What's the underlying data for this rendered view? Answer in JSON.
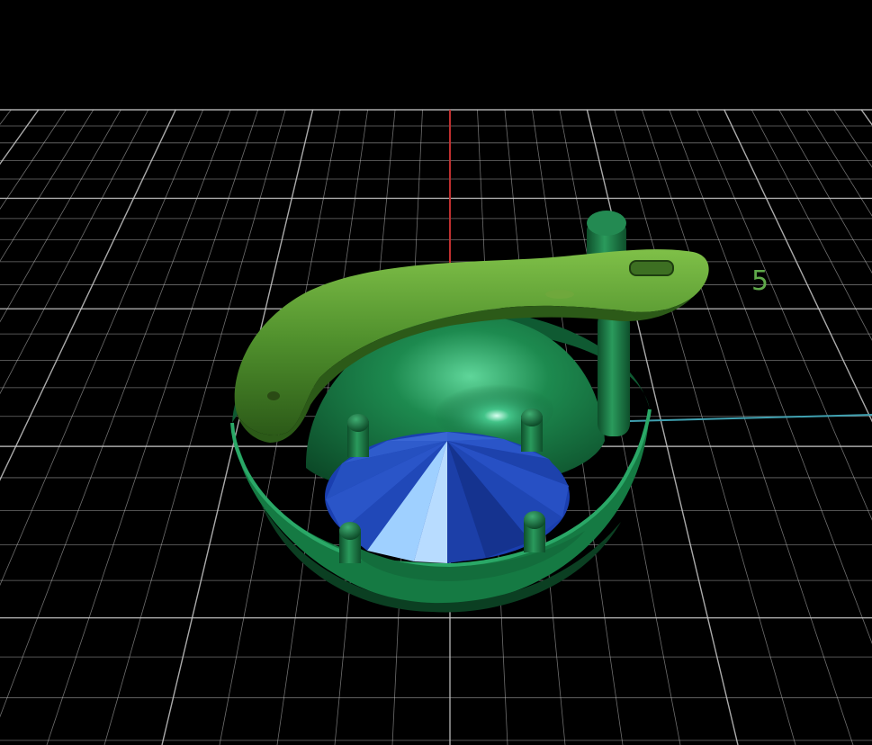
{
  "viewport": {
    "background": "#000000",
    "grid_color": "#c8c8c8",
    "axis_y_color": "#c03030",
    "axis_x_color": "#3fa0b0",
    "axis_label": "5"
  },
  "model": {
    "shell_color": "#1b7a46",
    "clasp_color": "#4f8f2c",
    "gem_color": "#1a3fb0",
    "gem_highlight": "#8cc0f8",
    "prong_count": 4
  }
}
